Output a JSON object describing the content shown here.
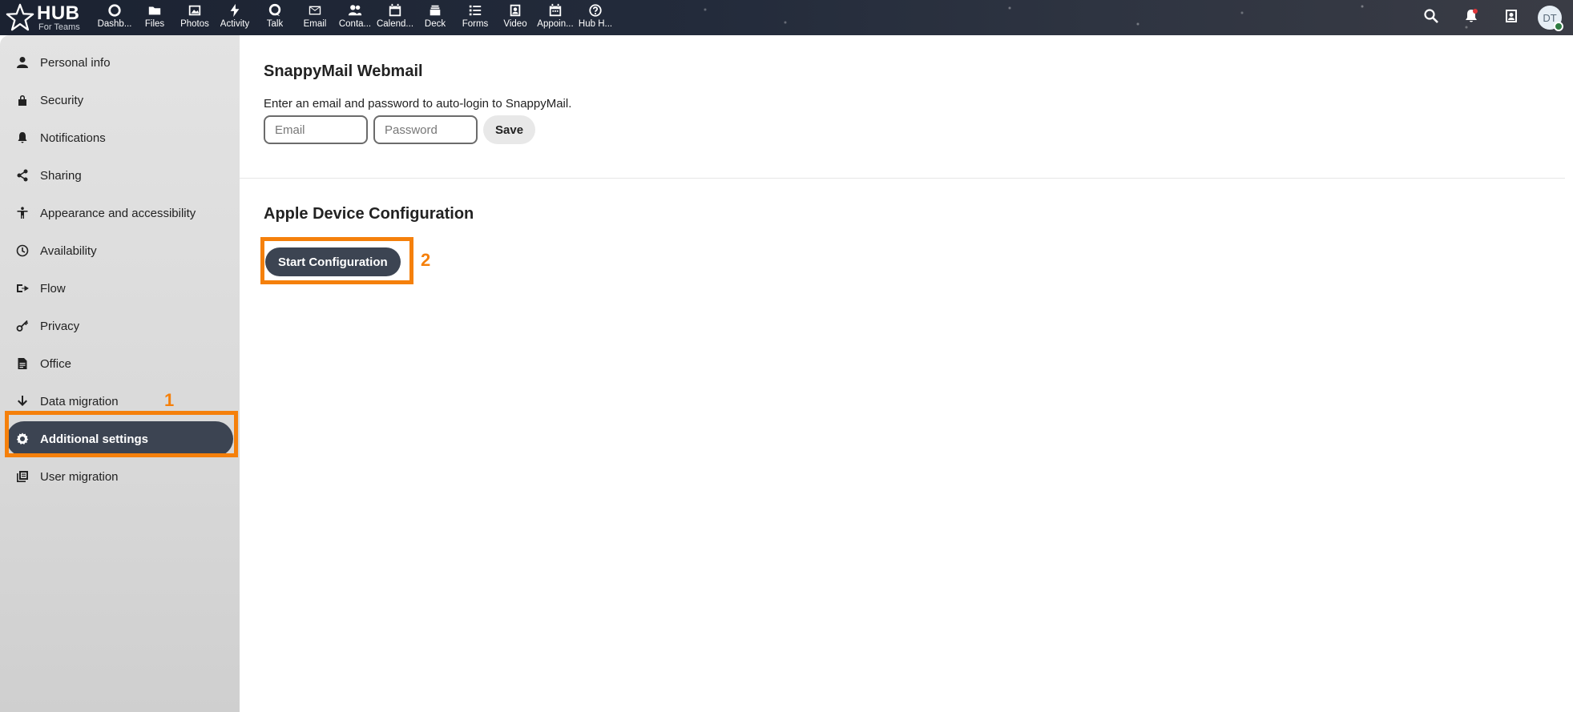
{
  "topbar": {
    "brand": "HUB",
    "brand_sub": "For Teams",
    "apps": [
      {
        "label": "Dashb..."
      },
      {
        "label": "Files"
      },
      {
        "label": "Photos"
      },
      {
        "label": "Activity"
      },
      {
        "label": "Talk"
      },
      {
        "label": "Email"
      },
      {
        "label": "Conta..."
      },
      {
        "label": "Calend..."
      },
      {
        "label": "Deck"
      },
      {
        "label": "Forms"
      },
      {
        "label": "Video"
      },
      {
        "label": "Appoin..."
      },
      {
        "label": "Hub H..."
      }
    ],
    "avatar_initials": "DT"
  },
  "sidebar": {
    "items": [
      {
        "label": "Personal info"
      },
      {
        "label": "Security"
      },
      {
        "label": "Notifications"
      },
      {
        "label": "Sharing"
      },
      {
        "label": "Appearance and accessibility"
      },
      {
        "label": "Availability"
      },
      {
        "label": "Flow"
      },
      {
        "label": "Privacy"
      },
      {
        "label": "Office"
      },
      {
        "label": "Data migration"
      },
      {
        "label": "Additional settings"
      },
      {
        "label": "User migration"
      }
    ],
    "active_index": 10
  },
  "snappymail": {
    "title": "SnappyMail Webmail",
    "description": "Enter an email and password to auto-login to SnappyMail.",
    "email_placeholder": "Email",
    "password_placeholder": "Password",
    "save_label": "Save"
  },
  "apple": {
    "title": "Apple Device Configuration",
    "start_label": "Start Configuration"
  },
  "annotations": {
    "callout_1": "1",
    "callout_2": "2",
    "color": "#f5800b"
  },
  "colors": {
    "accent": "#3c4452",
    "sidebar_bg": "#dcdcdc"
  }
}
